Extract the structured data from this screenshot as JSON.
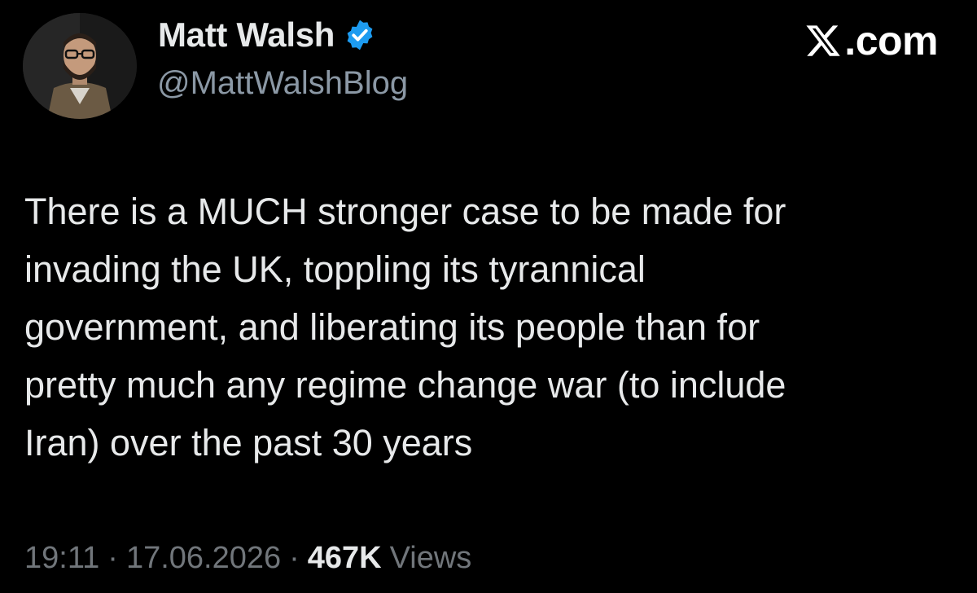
{
  "author": {
    "display_name": "Matt Walsh",
    "handle": "@MattWalshBlog",
    "verified": true,
    "verified_color": "#1d9bf0",
    "avatar_icon": "profile-photo"
  },
  "brand": {
    "text": ".com",
    "logo_icon": "x-logo-icon"
  },
  "tweet": {
    "lines": [
      "There is a MUCH stronger case to be made for",
      "invading the UK, toppling its tyrannical",
      "government, and liberating its people than for",
      "pretty much any regime change war (to include",
      "Iran) over the past 30 years"
    ]
  },
  "meta": {
    "time": "19:11",
    "separator": "·",
    "date": "17.06.2026",
    "views_count": "467K",
    "views_label": "Views"
  },
  "colors": {
    "background": "#000000",
    "text_primary": "#e7e9ea",
    "text_secondary": "#71767b",
    "accent": "#1d9bf0"
  }
}
